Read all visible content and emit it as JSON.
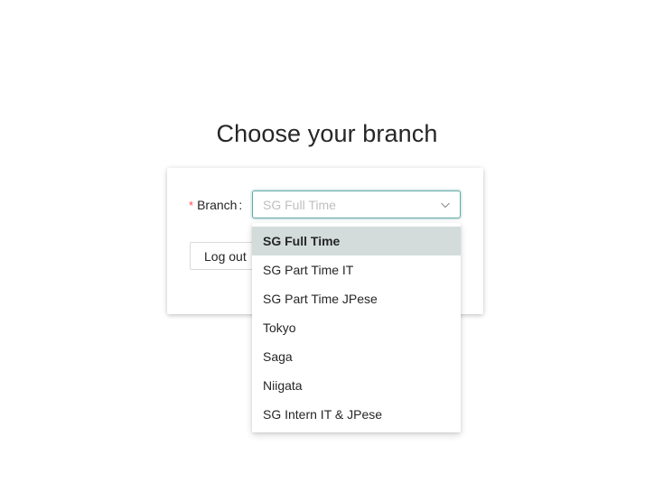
{
  "page": {
    "title": "Choose your branch"
  },
  "form": {
    "required_mark": "*",
    "branch_label": "Branch",
    "label_colon": ":",
    "branch_placeholder": "SG Full Time",
    "logout_label": "Log out"
  },
  "dropdown": {
    "options": [
      {
        "label": "SG Full Time",
        "selected": true
      },
      {
        "label": "SG Part Time IT",
        "selected": false
      },
      {
        "label": "SG Part Time JPese",
        "selected": false
      },
      {
        "label": "Tokyo",
        "selected": false
      },
      {
        "label": "Saga",
        "selected": false
      },
      {
        "label": "Niigata",
        "selected": false
      },
      {
        "label": "SG Intern IT & JPese",
        "selected": false
      }
    ]
  },
  "colors": {
    "accent_border": "#5fa8a3",
    "selected_option_bg": "#d3dcda",
    "required_mark": "#ff4d4f",
    "placeholder_text": "#bfbfbf"
  },
  "icons": {
    "select_arrow": "chevron-down-icon"
  }
}
